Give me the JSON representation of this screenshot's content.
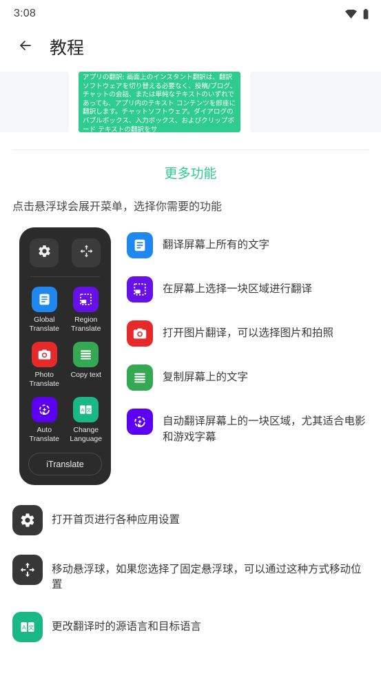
{
  "status_bar": {
    "time": "3:08",
    "wifi_icon": "wifi-icon",
    "battery_icon": "battery-icon"
  },
  "app_bar": {
    "back_icon": "back-arrow-icon",
    "title": "教程"
  },
  "carousel": {
    "cards": [
      {
        "type": "blank",
        "text": ""
      },
      {
        "type": "green",
        "text": "アプリの翻訳: 画面上のインスタント翻訳は、翻訳ソフトウェアを切り替える必要なく、投稿/ブログ、チャットの会話、または単純なテキストのいずれであっても、アプリ内のテキスト コンテンツを即座に翻訳します。チャットソフトウェア。ダイアログのバブルボックス、入力ボックス、およびクリップボード テキストの翻訳をサ"
      },
      {
        "type": "blank",
        "text": ""
      }
    ]
  },
  "section": {
    "title": "更多功能",
    "title_color": "#2ecc8f",
    "subtitle": "点击悬浮球会展开菜单，选择你需要的功能"
  },
  "ball_panel": {
    "background": "#2b2b2b",
    "top_buttons": [
      {
        "icon": "gear-icon",
        "name": "settings"
      },
      {
        "icon": "move-icon",
        "name": "move"
      }
    ],
    "items": [
      {
        "label": "Global\nTranslate",
        "label_line1": "Global",
        "label_line2": "Translate",
        "color": "#1f87f0",
        "icon": "document-lines-icon"
      },
      {
        "label": "Region\nTranslate",
        "label_line1": "Region",
        "label_line2": "Translate",
        "color": "#6611e8",
        "icon": "region-select-icon"
      },
      {
        "label": "Photo\nTranslate",
        "label_line1": "Photo",
        "label_line2": "Translate",
        "color": "#e52a29",
        "icon": "camera-icon"
      },
      {
        "label": "Copy text",
        "label_line1": "Copy text",
        "label_line2": "",
        "color": "#34a853",
        "icon": "text-lines-icon"
      },
      {
        "label": "Auto\nTranslate",
        "label_line1": "Auto",
        "label_line2": "Translate",
        "color": "#5b00f0",
        "icon": "auto-refresh-icon"
      },
      {
        "label": "Change\nLanguage",
        "label_line1": "Change",
        "label_line2": "Language",
        "color": "#19b884",
        "icon": "language-swap-icon"
      }
    ],
    "footer_label": "iTranslate"
  },
  "features": [
    {
      "icon": "document-lines-icon",
      "color": "#1f87f0",
      "text": "翻译屏幕上所有的文字"
    },
    {
      "icon": "region-select-icon",
      "color": "#6611e8",
      "text": "在屏幕上选择一块区域进行翻译"
    },
    {
      "icon": "camera-icon",
      "color": "#e52a29",
      "text": "打开图片翻译，可以选择图片和拍照"
    },
    {
      "icon": "text-lines-icon",
      "color": "#34a853",
      "text": "复制屏幕上的文字"
    },
    {
      "icon": "auto-refresh-icon",
      "color": "#5b00f0",
      "text": "自动翻译屏幕上的一块区域，尤其适合电影和游戏字幕"
    }
  ],
  "bottom_items": [
    {
      "icon": "gear-icon",
      "color": "#373737",
      "text": "打开首页进行各种应用设置"
    },
    {
      "icon": "move-icon",
      "color": "#373737",
      "text": "移动悬浮球，如果您选择了固定悬浮球，可以通过这种方式移动位置"
    },
    {
      "icon": "language-swap-icon",
      "color": "#19b884",
      "text": "更改翻译时的源语言和目标语言"
    }
  ]
}
